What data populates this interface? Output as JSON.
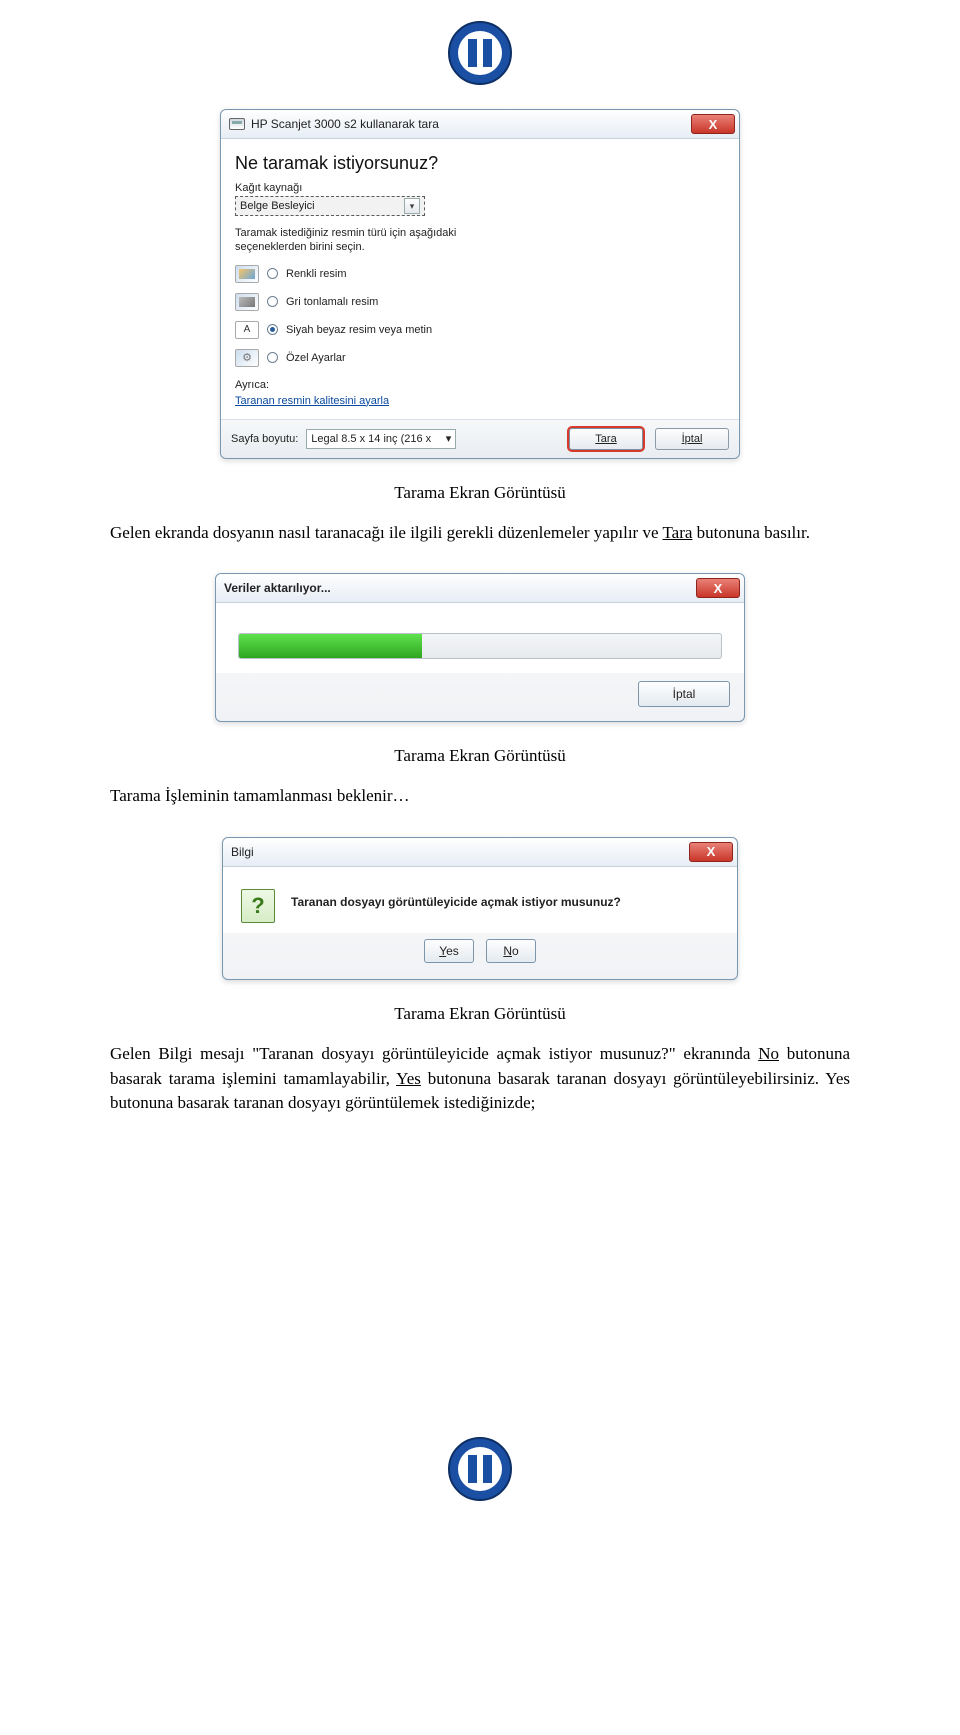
{
  "dialog_scan": {
    "title": "HP Scanjet 3000 s2 kullanarak tara",
    "close": "X",
    "heading": "Ne taramak istiyorsunuz?",
    "paper_source_label": "Kağıt kaynağı",
    "paper_source_value": "Belge Besleyici",
    "instruction": "Taramak istediğiniz resmin türü için aşağıdaki seçeneklerden birini seçin.",
    "opt_color": "Renkli resim",
    "opt_gray": "Gri tonlamalı resim",
    "opt_bw": "Siyah beyaz resim veya metin",
    "opt_custom": "Özel Ayarlar",
    "also_label": "Ayrıca:",
    "link_quality": "Taranan resmin kalitesini ayarla",
    "page_size_label": "Sayfa boyutu:",
    "page_size_value": "Legal 8.5 x 14 inç (216 x",
    "btn_scan": "Tara",
    "btn_cancel": "İptal"
  },
  "caption1": "Tarama Ekran Görüntüsü",
  "para1_a": "Gelen ekranda dosyanın nasıl taranacağı ile ilgili gerekli düzenlemeler yapılır ve ",
  "para1_u": "Tara",
  "para1_b": " butonuna basılır.",
  "dialog_progress": {
    "title": "Veriler aktarılıyor...",
    "close": "X",
    "btn_cancel": "İptal"
  },
  "caption2": "Tarama Ekran Görüntüsü",
  "para2": "Tarama İşleminin tamamlanması beklenir…",
  "dialog_info": {
    "title": "Bilgi",
    "close": "X",
    "message": "Taranan dosyayı görüntüleyicide açmak istiyor musunuz?",
    "yes": "Yes",
    "no": "No"
  },
  "caption3": "Tarama Ekran Görüntüsü",
  "para3_a": "Gelen Bilgi mesajı \"Taranan dosyayı görüntüleyicide açmak istiyor musunuz?\" ekranında ",
  "para3_no": "No",
  "para3_b": " butonuna basarak tarama işlemini tamamlayabilir, ",
  "para3_yes": "Yes",
  "para3_c": " butonuna basarak taranan dosyayı görüntüleyebilirsiniz. Yes butonuna basarak taranan dosyayı görüntülemek istediğinizde;"
}
